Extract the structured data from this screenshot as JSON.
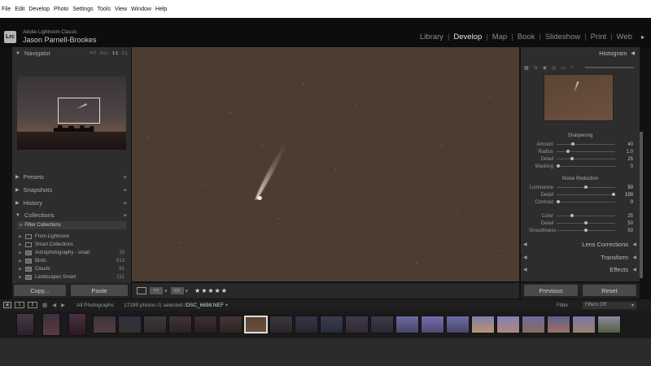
{
  "menu": [
    "File",
    "Edit",
    "Develop",
    "Photo",
    "Settings",
    "Tools",
    "View",
    "Window",
    "Help"
  ],
  "identity": {
    "logo": "Lrc",
    "product": "Adobe Lightroom Classic",
    "user": "Jason Parnell-Brookes"
  },
  "modules": [
    "Library",
    "Develop",
    "Map",
    "Book",
    "Slideshow",
    "Print",
    "Web"
  ],
  "active_module": "Develop",
  "left_panel": {
    "navigator": {
      "title": "Navigator",
      "options": [
        "FIT",
        "FILL",
        "1:1",
        "3:1"
      ],
      "selected": "1:1"
    },
    "sections": [
      {
        "title": "Presets"
      },
      {
        "title": "Snapshots"
      },
      {
        "title": "History"
      },
      {
        "title": "Collections"
      }
    ],
    "filter_collections": "Filter Collections",
    "collections": [
      {
        "name": "From Lightroom",
        "count": ""
      },
      {
        "name": "Smart Collections",
        "count": ""
      },
      {
        "name": "Astrophotography - smart",
        "count": "19"
      },
      {
        "name": "Birds",
        "count": "613"
      },
      {
        "name": "Clouds",
        "count": "81"
      },
      {
        "name": "Landscapes Smart",
        "count": "211"
      }
    ],
    "copy_button": "Copy...",
    "paste_button": "Paste"
  },
  "toolbar": {
    "rating": "★★★★★"
  },
  "right_panel": {
    "histogram_title": "Histogram",
    "sharpening": {
      "title": "Sharpening",
      "sliders": [
        {
          "label": "Amount",
          "value": "40",
          "level": 0.27
        },
        {
          "label": "Radius",
          "value": "1.0",
          "level": 0.17
        },
        {
          "label": "Detail",
          "value": "25",
          "level": 0.25
        },
        {
          "label": "Masking",
          "value": "0",
          "level": 0.0
        }
      ]
    },
    "noise_reduction": {
      "title": "Noise Reduction",
      "sliders": [
        {
          "label": "Luminance",
          "value": "50",
          "level": 0.5
        },
        {
          "label": "Detail",
          "value": "100",
          "level": 1.0
        },
        {
          "label": "Contrast",
          "value": "0",
          "level": 0.0
        }
      ],
      "color_sliders": [
        {
          "label": "Color",
          "value": "25",
          "level": 0.25
        },
        {
          "label": "Detail",
          "value": "50",
          "level": 0.5
        },
        {
          "label": "Smoothness",
          "value": "50",
          "level": 0.5
        }
      ]
    },
    "sections": [
      "Lens Corrections",
      "Transform",
      "Effects"
    ],
    "previous_button": "Previous",
    "reset_button": "Reset"
  },
  "filmstrip_bar": {
    "page1": "1",
    "page2": "2",
    "source": "All Photographs",
    "count": "17299 photos /1 selected /",
    "filename": "DSC_6698.NEF",
    "filter_label": "Filter :",
    "filter_value": "Filters Off"
  },
  "colors": {
    "panel": "#2d2d2d",
    "background": "#111111",
    "image": "#4d3d31"
  }
}
